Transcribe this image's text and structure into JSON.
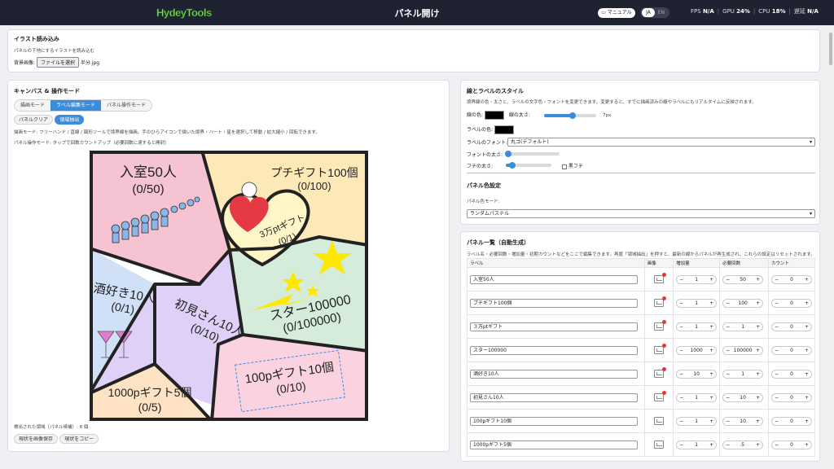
{
  "header": {
    "logo": "HydeyTools",
    "title": "パネル開け",
    "manual": "マニュアル",
    "lang_ja": "JA",
    "lang_en": "EN",
    "fps_label": "FPS",
    "fps_value": "N/A",
    "gpu_label": "GPU",
    "gpu_value": "24",
    "cpu_label": "CPU",
    "cpu_value": "18",
    "delay_label": "遅延",
    "delay_value": "N/A"
  },
  "illust": {
    "title": "イラスト読み込み",
    "desc": "パネルの下地にするイラストを読み込む",
    "bg_label": "背景画像:",
    "file_button": "ファイルを選択",
    "file_name": "半分.jpg"
  },
  "canvas": {
    "title": "キャンバス & 操作モード",
    "modes": [
      "描画モード",
      "ラベル編集モード",
      "パネル操作モード"
    ],
    "clear": "パネルクリア",
    "detect": "領域抽出",
    "draw_desc": "描画モード: フリーハンド / 直線 / 図形ツールで境界線を描画。手のひらアイコンで描いた境界・ハート・星を選択して移動 / 拡大縮小 / 回転できます。",
    "panel_desc": "パネル操作モード: タップで回数カウントアップ（必要回数に達すると開封）",
    "detected": "検出された領域（パネル候補）: 8 個",
    "save_image": "現状を画像保存",
    "copy": "現状をコピー",
    "panels": {
      "p1": "入室50人",
      "p1c": "(0/50)",
      "p2": "プチギフト100個",
      "p2c": "(0/100)",
      "p3": "3万ptギフト",
      "p3c": "(0/1)",
      "p4": "スター100000",
      "p4c": "(0/100000)",
      "p5": "酒好き10人",
      "p5c": "(0/1)",
      "p6": "初見さん10人",
      "p6c": "(0/10)",
      "p7": "100pギフト10個",
      "p7c": "(0/10)",
      "p8": "1000pギフト5個",
      "p8c": "(0/5)"
    }
  },
  "style": {
    "title": "線とラベルのスタイル",
    "desc": "境界線の色・太さと、ラベルの文字色・フォントを変更できます。変更すると、すでに描画済みの線やラベルにもリアルタイムに反映されます。",
    "line_color": "線の色:",
    "line_width": "線の太さ:",
    "line_width_value": "7px",
    "label_color": "ラベルの色:",
    "label_font": "ラベルのフォント:",
    "font_value": "丸ゴ(デフォルト)",
    "font_size": "フォントの太さ:",
    "edge_size": "フチの太さ:",
    "black_edge": "黒フチ",
    "line_width_level": 0.55,
    "font_size_level": 0.05,
    "edge_size_level": 0.15
  },
  "colorset": {
    "title": "パネル色設定",
    "mode_label": "パネル色モード:",
    "mode_value": "ランダムパステル"
  },
  "list": {
    "title": "パネル一覧（自動生成）",
    "desc": "ラベル名・必要回数・増加量・初期カウントなどをここで編集できます。再度「領域抽出」を押すと、最新の線からパネルが再生成され、これらの設定はリセットされます。",
    "headers": [
      "ラベル",
      "画像",
      "増加量",
      "必要回数",
      "カウント"
    ],
    "rows": [
      {
        "label": "入室50人",
        "inc": "1",
        "req": "50",
        "count": "0"
      },
      {
        "label": "プチギフト100個",
        "inc": "1",
        "req": "100",
        "count": "0"
      },
      {
        "label": "３万ptギフト",
        "inc": "1",
        "req": "1",
        "count": "0"
      },
      {
        "label": "スター100000",
        "inc": "1000",
        "req": "100000",
        "count": "0"
      },
      {
        "label": "酒好き10人",
        "inc": "10",
        "req": "1",
        "count": "0"
      },
      {
        "label": "初見さん10人",
        "inc": "1",
        "req": "10",
        "count": "0"
      },
      {
        "label": "100pギフト10個",
        "inc": "1",
        "req": "10",
        "count": "0"
      },
      {
        "label": "1000pギフト5個",
        "inc": "1",
        "req": "5",
        "count": "0"
      }
    ]
  },
  "colors": {
    "accent": "#3a8dde",
    "header_bg": "#1e2231"
  }
}
